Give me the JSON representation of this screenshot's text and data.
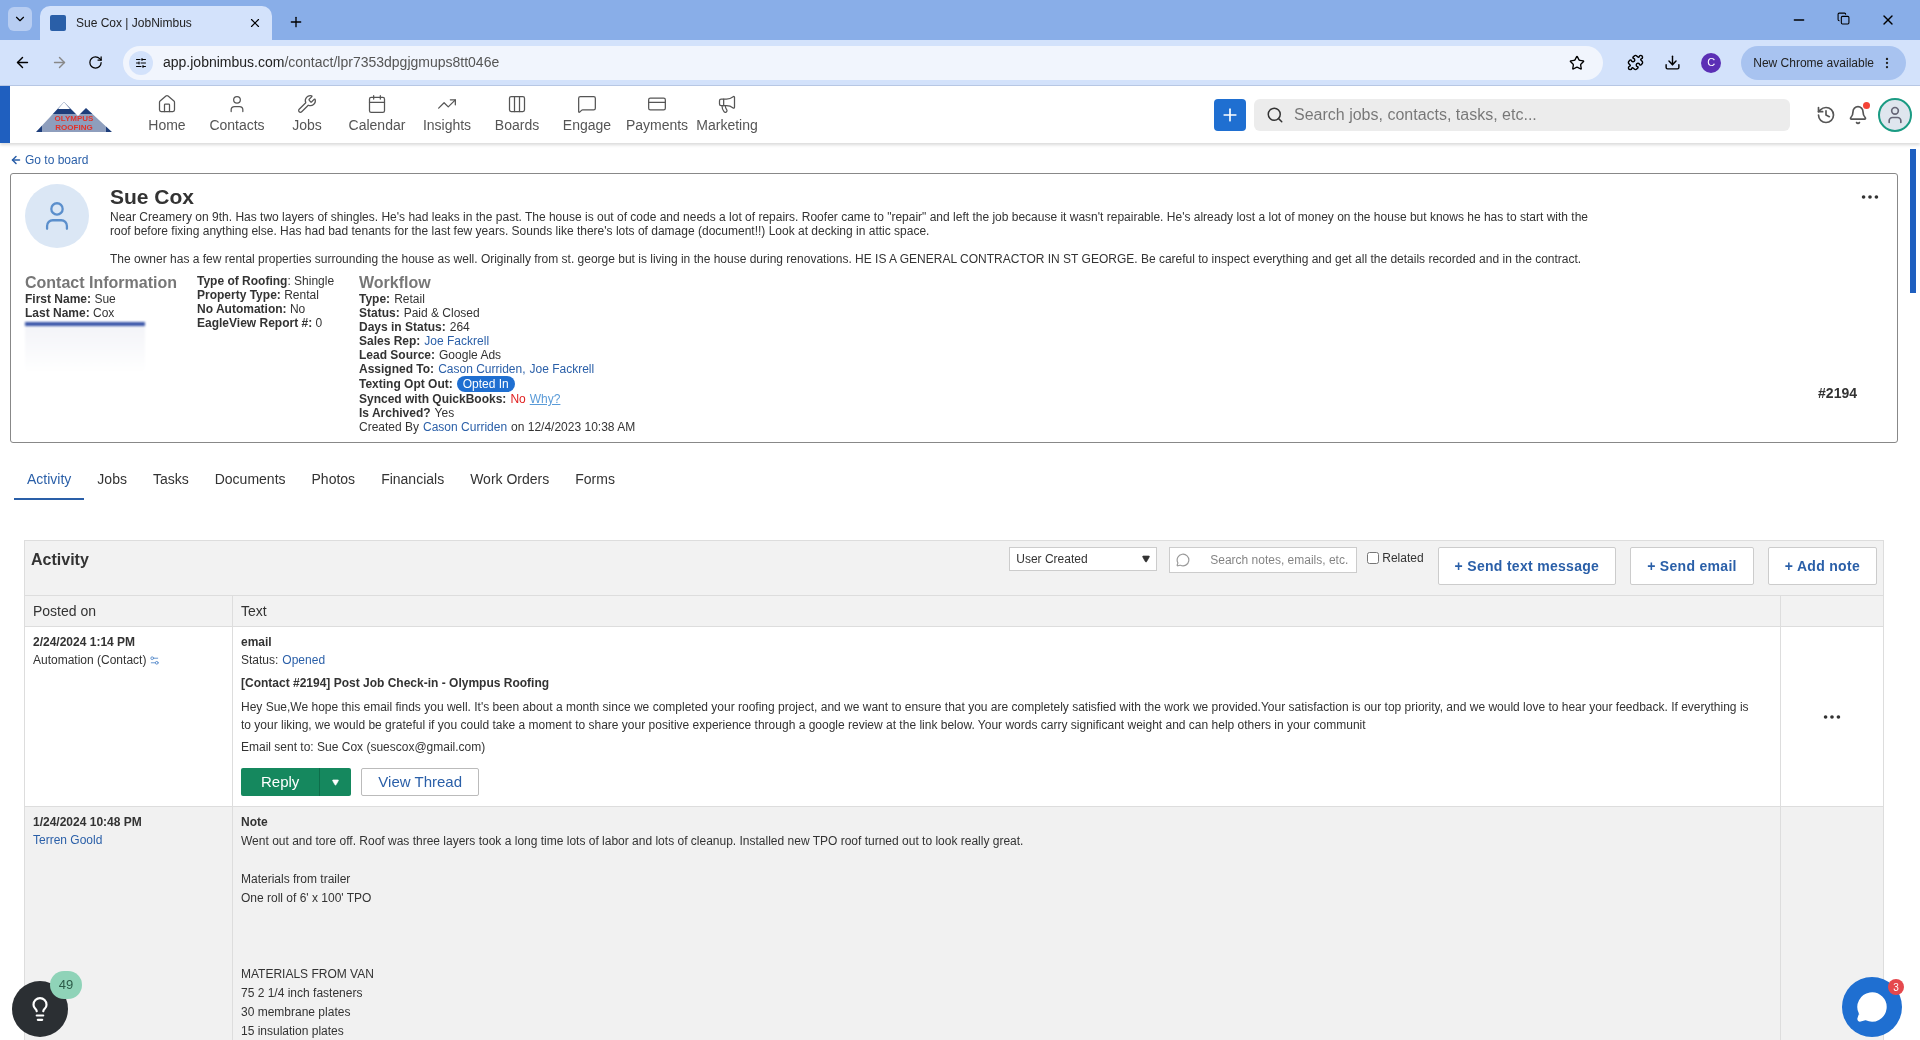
{
  "browser": {
    "tab_title": "Sue Cox | JobNimbus",
    "url_host": "app.jobnimbus.com",
    "url_path": "/contact/lpr7353dpgjgmups8tt046e",
    "profile_initial": "C",
    "update_button": "New Chrome available"
  },
  "app_nav": {
    "logo_text": "OLYMPUS ROOFING",
    "items": [
      {
        "label": "Home",
        "kind": "home"
      },
      {
        "label": "Contacts",
        "kind": "contacts"
      },
      {
        "label": "Jobs",
        "kind": "jobs"
      },
      {
        "label": "Calendar",
        "kind": "calendar"
      },
      {
        "label": "Insights",
        "kind": "insights"
      },
      {
        "label": "Boards",
        "kind": "boards"
      },
      {
        "label": "Engage",
        "kind": "engage"
      },
      {
        "label": "Payments",
        "kind": "payments"
      },
      {
        "label": "Marketing",
        "kind": "marketing"
      }
    ],
    "search_placeholder": "Search jobs, contacts, tasks, etc...",
    "has_notification": true
  },
  "contact": {
    "back_link": "Go to board",
    "name": "Sue Cox",
    "notes": [
      "Near Creamery on 9th. Has two layers of shingles. He's had leaks in the past. The house is out of code and needs a lot of repairs. Roofer came to \"repair\" and left the job because it wasn't repairable. He's already lost a lot of money on the house but knows he has to start with the roof before fixing anything else. Has had bad tenants for the last few years. Sounds like there's lots of damage (document!!) Look at decking in attic space.",
      "The owner has a few rental properties surrounding the house as well. Originally from st. george but is living in the house during renovations. HE IS A GENERAL CONTRACTOR IN ST GEORGE. Be careful to inspect everything and get all the details recorded and in the contract."
    ],
    "contact_info": {
      "heading": "Contact Information",
      "fields": [
        {
          "label": "First Name:",
          "value": "Sue"
        },
        {
          "label": "Last Name:",
          "value": "Cox"
        }
      ]
    },
    "details": [
      {
        "label": "Type of Roofing",
        "value": ": Shingle"
      },
      {
        "label": "Property Type:",
        "value": "Rental"
      },
      {
        "label": "No Automation:",
        "value": "No"
      },
      {
        "label": "EagleView Report #:",
        "value": "0"
      }
    ],
    "workflow": {
      "heading": "Workflow",
      "rows": [
        {
          "kind": "field",
          "label": "Type:",
          "parts": [
            {
              "kind": "plain",
              "text": "Retail"
            }
          ]
        },
        {
          "kind": "field",
          "label": "Status:",
          "parts": [
            {
              "kind": "plain",
              "text": "Paid & Closed"
            }
          ]
        },
        {
          "kind": "field",
          "label": "Days in Status:",
          "parts": [
            {
              "kind": "plain",
              "text": "264"
            }
          ]
        },
        {
          "kind": "field",
          "label": "Sales Rep:",
          "parts": [
            {
              "kind": "link",
              "text": "Joe Fackrell"
            }
          ]
        },
        {
          "kind": "field",
          "label": "Lead Source:",
          "parts": [
            {
              "kind": "plain",
              "text": "Google Ads"
            }
          ]
        },
        {
          "kind": "field",
          "label": "Assigned To:",
          "parts": [
            {
              "kind": "link",
              "text": "Cason Curriden,"
            },
            {
              "kind": "link",
              "text": "Joe Fackrell"
            }
          ]
        },
        {
          "kind": "field",
          "label": "Texting Opt Out:",
          "parts": [
            {
              "kind": "badge",
              "text": "Opted In"
            }
          ]
        },
        {
          "kind": "field",
          "label": "Synced with QuickBooks:",
          "parts": [
            {
              "kind": "negative",
              "text": "No"
            },
            {
              "kind": "help",
              "text": "Why?"
            }
          ]
        },
        {
          "kind": "field",
          "label": "Is Archived?",
          "parts": [
            {
              "kind": "plain",
              "text": "Yes"
            }
          ]
        },
        {
          "kind": "byline",
          "label": "Created By",
          "parts": [
            {
              "kind": "link",
              "text": "Cason Curriden"
            },
            {
              "kind": "plain",
              "text": "on 12/4/2023 10:38 AM"
            }
          ]
        }
      ]
    },
    "number": "#2194"
  },
  "tabs": [
    {
      "label": "Activity",
      "selected": true
    },
    {
      "label": "Jobs",
      "selected": false
    },
    {
      "label": "Tasks",
      "selected": false
    },
    {
      "label": "Documents",
      "selected": false
    },
    {
      "label": "Photos",
      "selected": false
    },
    {
      "label": "Financials",
      "selected": false
    },
    {
      "label": "Work Orders",
      "selected": false
    },
    {
      "label": "Forms",
      "selected": false
    }
  ],
  "activity": {
    "title": "Activity",
    "filter": "User Created",
    "search_placeholder": "Search notes, emails, etc.",
    "related": {
      "label": "Related",
      "checked": false
    },
    "buttons": [
      "+ Send text message",
      "+ Send email",
      "+ Add note"
    ],
    "columns": [
      "Posted on",
      "Text"
    ],
    "rows": [
      {
        "kind": "email",
        "date": "2/24/2024 1:14 PM",
        "author": "Automation (Contact)",
        "type": "email",
        "status_label": "Status:",
        "status": "Opened",
        "subject": "[Contact #2194] Post Job Check-in - Olympus Roofing",
        "body": "Hey Sue,We hope this email finds you well. It's been about a month since we completed your roofing project, and we want to ensure that you are completely satisfied with the work we provided.Your satisfaction is our top priority, and we would love to hear your feedback. If everything is to your liking, we would be grateful if you could take a moment to share your positive experience through a google review at the link below. Your words carry significant weight and can help others in your communit",
        "sent_to": "Email sent to: Sue Cox (suescox@gmail.com)",
        "reply": "Reply",
        "view_thread": "View Thread"
      },
      {
        "kind": "note",
        "date": "1/24/2024 10:48 PM",
        "author": "Terren Goold",
        "type": "Note",
        "groups": [
          [
            "Went out and tore off. Roof was three layers took a long time lots of labor and lots of cleanup. Installed new TPO roof turned out to look really great."
          ],
          [
            "Materials from trailer",
            "One roll of 6' x 100' TPO"
          ],
          [
            "MATERIALS FROM VAN",
            "75 2 1/4 inch fasteners",
            "30 membrane plates",
            "15 insulation plates"
          ]
        ]
      }
    ]
  },
  "help_badge": "49",
  "chat_badge": "3"
}
